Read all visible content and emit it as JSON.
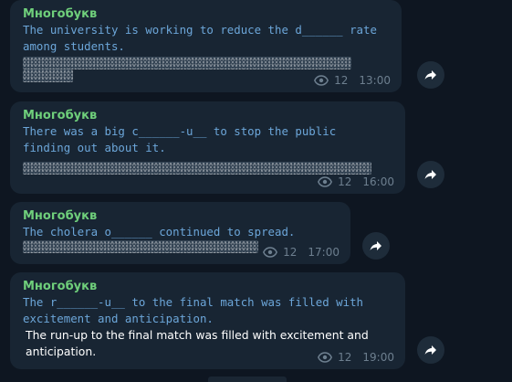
{
  "messages": [
    {
      "author": "Многобукв",
      "text": "The university is working to reduce the d______ rate\namong students.",
      "has_spoiler": true,
      "views": "12",
      "time": "13:00"
    },
    {
      "author": "Многобукв",
      "text": "There was a big c______-u__ to stop the public\nfinding out about it.",
      "has_spoiler": true,
      "views": "12",
      "time": "16:00"
    },
    {
      "author": "Многобукв",
      "text": "The cholera o______ continued to spread.",
      "has_spoiler": true,
      "views": "12",
      "time": "17:00"
    },
    {
      "author": "Многобукв",
      "text": "The r______-u__ to the final match was filled with\nexcitement and anticipation.",
      "plain_text": "The run-up to the final match was filled with excitement and anticipation.",
      "views": "12",
      "time": "19:00"
    }
  ],
  "icons": {
    "views": "eye-icon",
    "share": "share-arrow-icon"
  },
  "colors": {
    "background": "#0e1621",
    "bubble": "#182533",
    "author": "#6fcf7b",
    "mono_text": "#6ca6d9",
    "meta": "#6d7f8f"
  }
}
